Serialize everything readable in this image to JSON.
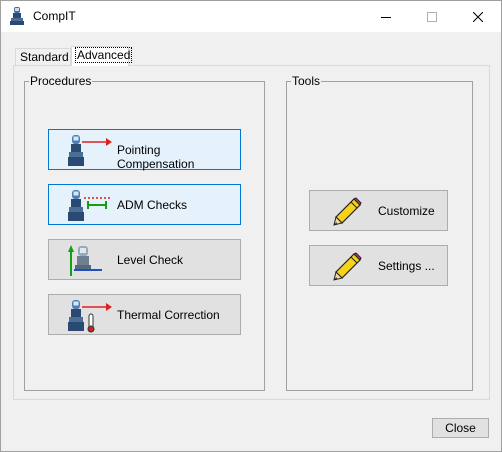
{
  "window": {
    "title": "CompIT",
    "icon": "compit-app-icon",
    "controls": [
      "minimize-icon",
      "maximize-icon",
      "close-icon"
    ]
  },
  "tabs": [
    {
      "label": "Standard",
      "active": false
    },
    {
      "label": "Advanced",
      "active": true
    }
  ],
  "procedures": {
    "label": "Procedures",
    "buttons": [
      {
        "label": "Pointing Compensation",
        "icon": "pointing-compensation-icon",
        "highlighted": true
      },
      {
        "label": "ADM Checks",
        "icon": "adm-checks-icon",
        "highlighted": true
      },
      {
        "label": "Level Check",
        "icon": "level-check-icon",
        "highlighted": false
      },
      {
        "label": "Thermal Correction",
        "icon": "thermal-correction-icon",
        "highlighted": false
      }
    ]
  },
  "tools": {
    "label": "Tools",
    "buttons": [
      {
        "label": "Customize",
        "icon": "pencil-icon"
      },
      {
        "label": "Settings ...",
        "icon": "pencil-icon"
      }
    ]
  },
  "footer": {
    "close_label": "Close"
  },
  "colors": {
    "highlight_border": "#0078d7",
    "highlight_fill": "#e5f1fb",
    "button_fill": "#e1e1e1",
    "arrow_red": "#e02020",
    "arrow_green": "#10a010",
    "tracker_blue": "#2a4a73"
  }
}
